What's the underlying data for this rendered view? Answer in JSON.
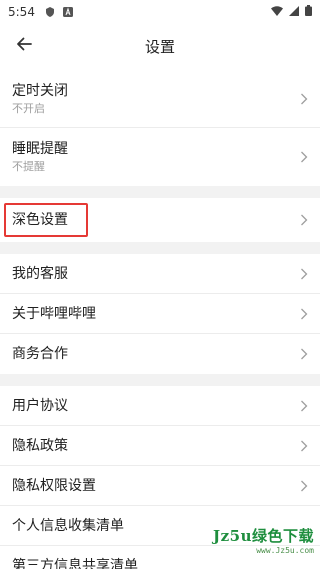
{
  "status_bar": {
    "time": "5:54"
  },
  "header": {
    "title": "设置",
    "back_icon": "arrow-left-icon"
  },
  "groups": [
    {
      "items": [
        {
          "label": "定时关闭",
          "sub": "不开启"
        },
        {
          "label": "睡眠提醒",
          "sub": "不提醒"
        }
      ]
    },
    {
      "items": [
        {
          "label": "深色设置",
          "highlighted": true
        }
      ]
    },
    {
      "items": [
        {
          "label": "我的客服"
        },
        {
          "label": "关于哔哩哔哩"
        },
        {
          "label": "商务合作"
        }
      ]
    },
    {
      "items": [
        {
          "label": "用户协议"
        },
        {
          "label": "隐私政策"
        },
        {
          "label": "隐私权限设置"
        },
        {
          "label": "个人信息收集清单"
        },
        {
          "label": "第三方信息共享清单"
        }
      ]
    }
  ],
  "watermark": {
    "brand": "Jz5u绿色下载",
    "url": "www.Jz5u.com"
  },
  "colors": {
    "highlight": "#e53935",
    "divider": "#ececec",
    "group_gap": "#f2f2f2",
    "watermark": "#1e8e3e"
  }
}
